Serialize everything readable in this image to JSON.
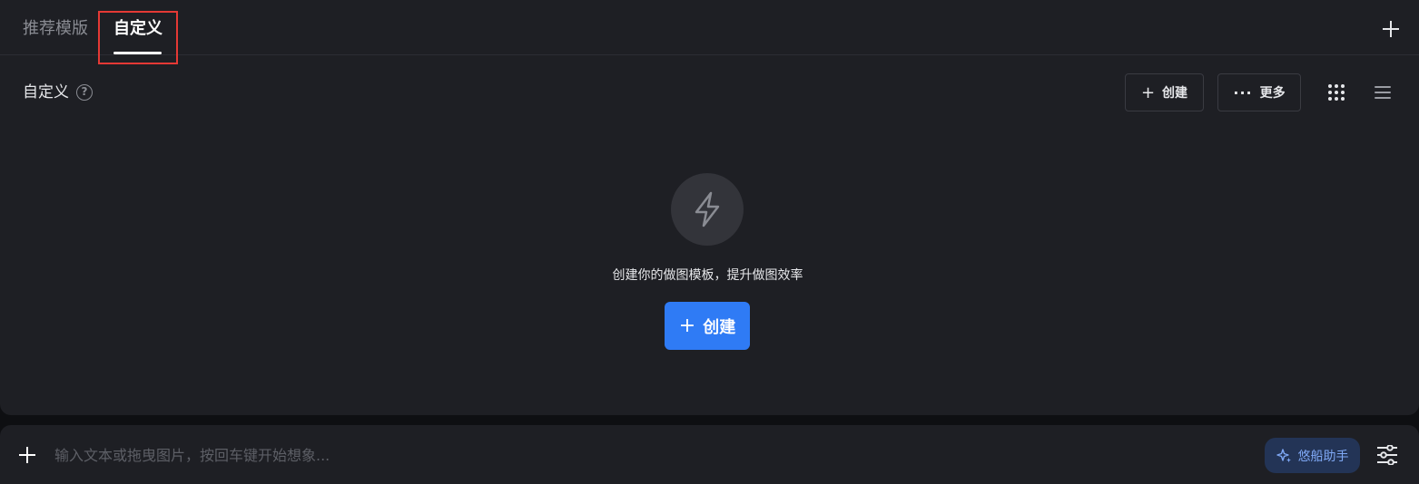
{
  "tabs": [
    {
      "label": "推荐模版",
      "active": false
    },
    {
      "label": "自定义",
      "active": true
    }
  ],
  "section": {
    "title": "自定义",
    "help_icon": "question-circle-icon"
  },
  "toolbar": {
    "create_label": "创建",
    "more_label": "更多",
    "view_modes": [
      "grid-view-icon",
      "list-view-icon"
    ]
  },
  "empty_state": {
    "icon": "lightning-icon",
    "message": "创建你的做图模板，提升做图效率",
    "create_label": "创建"
  },
  "input_bar": {
    "placeholder": "输入文本或拖曳图片，按回车键开始想象...",
    "value": "",
    "assistant_label": "悠船助手"
  },
  "colors": {
    "background": "#1e1f24",
    "accent": "#2f7bf5",
    "highlight_box": "#e53935",
    "assistant_bg": "#233456",
    "assistant_text": "#7fa8f5"
  }
}
